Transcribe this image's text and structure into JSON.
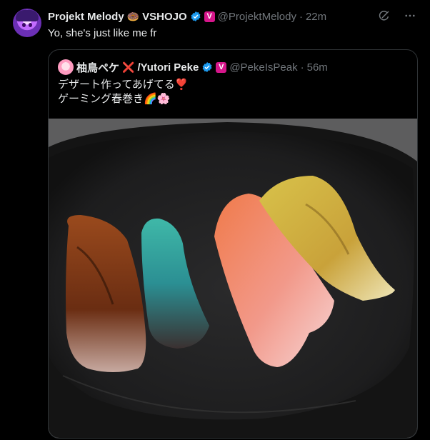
{
  "tweet": {
    "author": {
      "name": "Projekt Melody",
      "emoji": "🍩",
      "group": "VSHOJO",
      "badge": "V",
      "handle": "@ProjektMelody",
      "time": "22m"
    },
    "text": "Yo, she's just like me fr",
    "icons": [
      "grok-icon",
      "more-icon"
    ]
  },
  "quote": {
    "author": {
      "name": "柚鳥ペケ",
      "cross": "❌",
      "alias": "/Yutori Peke",
      "badge": "V",
      "handle": "@PekeIsPeak",
      "time": "56m"
    },
    "line1": "デザート作ってあげてる",
    "line1_emoji": "❣️",
    "line2": "ゲーミング春巻き",
    "line2_emoji": "🌈🌸"
  },
  "colors": {
    "accent_verified": "#1d9bf0",
    "vshojo_badge": "#d6168b",
    "muted": "#71767b",
    "border": "#2f3336"
  }
}
